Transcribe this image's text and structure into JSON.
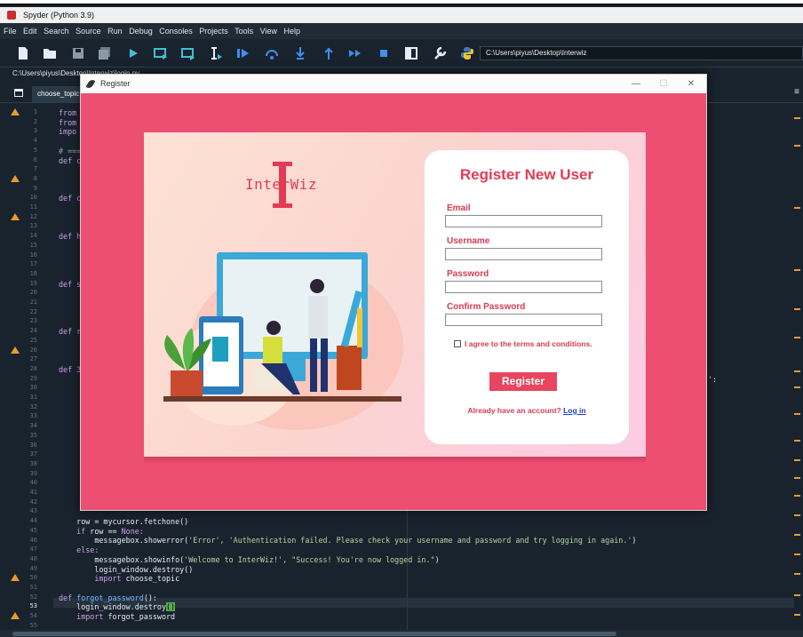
{
  "window": {
    "title": "Spyder (Python 3.9)"
  },
  "menu": [
    "File",
    "Edit",
    "Search",
    "Source",
    "Run",
    "Debug",
    "Consoles",
    "Projects",
    "Tools",
    "View",
    "Help"
  ],
  "toolbar": {
    "working_dir": "C:\\Users\\piyus\\Desktop\\Interwiz"
  },
  "file_path": "C:\\Users\\piyus\\Desktop\\Interwiz\\login.py",
  "editor_tab": "choose_topic",
  "line_numbers": [
    "1",
    "2",
    "3",
    "4",
    "5",
    "6",
    "7",
    "8",
    "9",
    "10",
    "11",
    "12",
    "13",
    "14",
    "15",
    "16",
    "17",
    "18",
    "19",
    "20",
    "21",
    "22",
    "23",
    "24",
    "25",
    "26",
    "27",
    "28",
    "29",
    "30",
    "31",
    "32",
    "33",
    "34",
    "35",
    "36",
    "37",
    "38",
    "39",
    "40",
    "41",
    "42",
    "43",
    "44",
    "45",
    "46",
    "47",
    "48",
    "49",
    "50",
    "51",
    "52",
    "53",
    "54",
    "55"
  ],
  "current_line": "53",
  "code_fragments": {
    "l1": "from",
    "l2": "from",
    "l3": "impo",
    "l5": "# ===",
    "l6": "def c",
    "l10": "def c",
    "l14": "def h",
    "l19": "def s",
    "l24": "def r",
    "l28": "def 3",
    "l29_right": "':"
  },
  "code": {
    "l44": "    row = mycursor.fetchone()",
    "l45_kw": "    if",
    "l45_rest": " row == ",
    "l45_none": "None:",
    "l46_pre": "        messagebox.showerror(",
    "l46_str": "'Error', 'Authentication failed. Please check your username and password and try logging in again.'",
    "l46_post": ")",
    "l47_kw": "    else:",
    "l48_pre": "        messagebox.showinfo(",
    "l48_str": "'Welcome to InterWiz!', \"Success! You're now logged in.\"",
    "l48_post": ")",
    "l49": "        login_window.destroy()",
    "l50_kw": "        import",
    "l50_rest": " choose_topic",
    "l52_kw": "def",
    "l52_fn": " forgot_password",
    "l52_rest": "():",
    "l53_pre": "    login_window.destroy",
    "l53_cursor": "()",
    "l54_kw": "    import",
    "l54_rest": " forgot_password"
  },
  "dialog": {
    "title": "Register",
    "logo_text": "InterWiz",
    "form_title": "Register New User",
    "email_label": "Email",
    "username_label": "Username",
    "password_label": "Password",
    "confirm_label": "Confirm Password",
    "agree_text": "I agree to the terms and conditions.",
    "register_button": "Register",
    "have_account": "Already have an account? ",
    "login_link": "Log in"
  },
  "colors": {
    "accent": "#ec4f71",
    "button": "#e8455f",
    "label": "#d83a52",
    "link": "#1d3fcf",
    "editor_bg": "#19232d",
    "warning": "#ea9a2b"
  }
}
